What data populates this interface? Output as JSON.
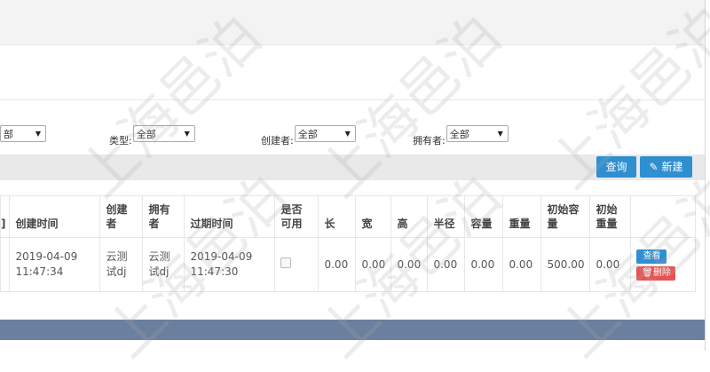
{
  "filters": [
    {
      "label": "",
      "value": "部"
    },
    {
      "label": "类型:",
      "value": "全部"
    },
    {
      "label": "创建者:",
      "value": "全部"
    },
    {
      "label": "拥有者:",
      "value": "全部"
    }
  ],
  "toolbar": {
    "query_label": "查询",
    "new_label": "新建"
  },
  "table": {
    "headers": [
      {
        "line1": "",
        "line2": "]"
      },
      {
        "line1": "",
        "line2": "创建时间"
      },
      {
        "line1": "创建",
        "line2": "者"
      },
      {
        "line1": "拥有",
        "line2": "者"
      },
      {
        "line1": "",
        "line2": "过期时间"
      },
      {
        "line1": "是否",
        "line2": "可用"
      },
      {
        "line1": "",
        "line2": "长"
      },
      {
        "line1": "",
        "line2": "宽"
      },
      {
        "line1": "",
        "line2": "高"
      },
      {
        "line1": "",
        "line2": "半径"
      },
      {
        "line1": "",
        "line2": "容量"
      },
      {
        "line1": "",
        "line2": "重量"
      },
      {
        "line1": "初始容",
        "line2": "量"
      },
      {
        "line1": "初始",
        "line2": "重量"
      },
      {
        "line1": "",
        "line2": ""
      }
    ],
    "row": {
      "created_date": "2019-04-09",
      "created_time": "11:47:34",
      "creator_l1": "云测",
      "creator_l2": "试dj",
      "owner_l1": "云测",
      "owner_l2": "试dj",
      "expire_date": "2019-04-09",
      "expire_time": "11:47:30",
      "length": "0.00",
      "width": "0.00",
      "height": "0.00",
      "radius": "0.00",
      "capacity": "0.00",
      "weight": "0.00",
      "init_capacity": "500.00",
      "init_weight": "0.00",
      "view_label": "查看",
      "delete_label": "删除"
    }
  },
  "watermark": "上海邑泊"
}
